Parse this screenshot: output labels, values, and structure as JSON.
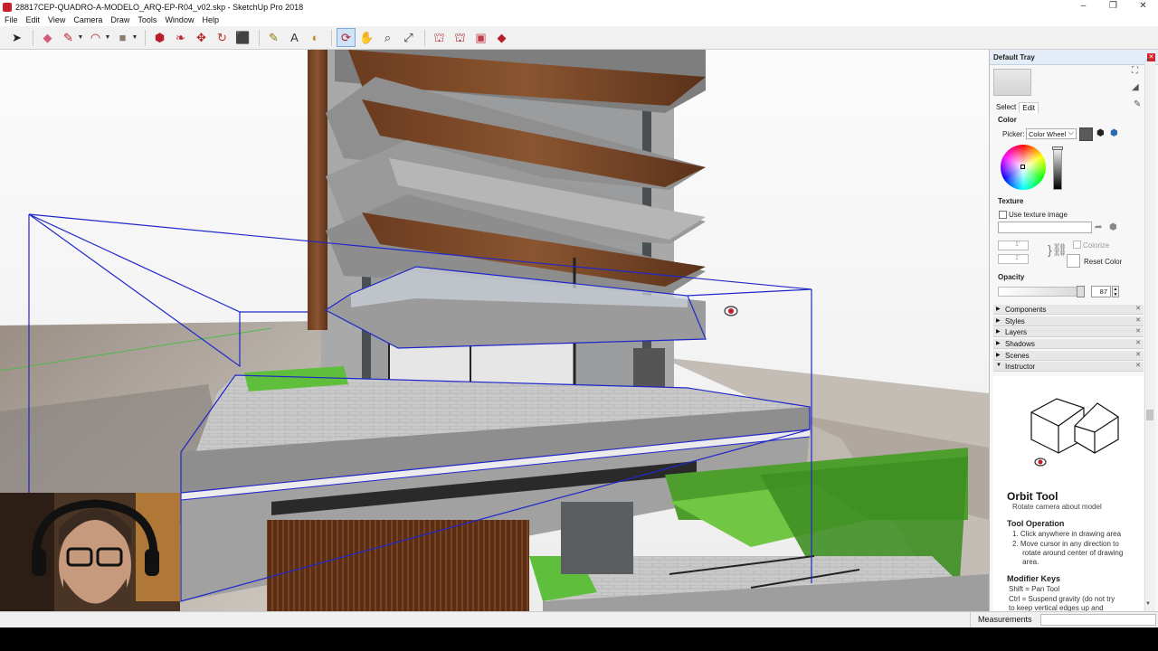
{
  "window": {
    "title": "28817CEP-QUADRO-A-MODELO_ARQ-EP-R04_v02.skp - SketchUp Pro 2018",
    "controls": [
      "–",
      "❐",
      "✕"
    ]
  },
  "menu": [
    "File",
    "Edit",
    "View",
    "Camera",
    "Draw",
    "Tools",
    "Window",
    "Help"
  ],
  "toolbar": {
    "icons": [
      {
        "name": "select-icon",
        "glyph": "➤",
        "color": "#222"
      },
      {
        "name": "eraser-icon",
        "glyph": "◆",
        "color": "#d45a7c"
      },
      {
        "name": "pencil-icon",
        "glyph": "✎",
        "color": "#b5202a"
      },
      {
        "name": "arc-icon",
        "glyph": "◠",
        "color": "#b5202a"
      },
      {
        "name": "rectangle-icon",
        "glyph": "■",
        "color": "#8a7d6f"
      },
      {
        "name": "push-pull-icon",
        "glyph": "⬢",
        "color": "#b5202a"
      },
      {
        "name": "follow-me-icon",
        "glyph": "❧",
        "color": "#b5202a"
      },
      {
        "name": "move-icon",
        "glyph": "✥",
        "color": "#b5202a"
      },
      {
        "name": "rotate-icon",
        "glyph": "↻",
        "color": "#c0302a"
      },
      {
        "name": "scale-icon",
        "glyph": "⬛",
        "color": "#b5202a"
      },
      {
        "name": "tape-measure-icon",
        "glyph": "✎",
        "color": "#8b7a14"
      },
      {
        "name": "text-icon",
        "glyph": "A",
        "color": "#333"
      },
      {
        "name": "paint-bucket-icon",
        "glyph": "◐",
        "color": "#b98c2a"
      },
      {
        "name": "orbit-icon",
        "glyph": "⟳",
        "color": "#b5202a"
      },
      {
        "name": "pan-icon",
        "glyph": "✋",
        "color": "#c68e3a"
      },
      {
        "name": "zoom-icon",
        "glyph": "⌕",
        "color": "#333"
      },
      {
        "name": "zoom-extents-icon",
        "glyph": "⤢",
        "color": "#333"
      },
      {
        "name": "warehouse-icon",
        "glyph": "⛫",
        "color": "#c0303a"
      },
      {
        "name": "extension-warehouse-icon",
        "glyph": "⛫",
        "color": "#a02030"
      },
      {
        "name": "send-to-layout-icon",
        "glyph": "▣",
        "color": "#c23a4a"
      },
      {
        "name": "extension-icon",
        "glyph": "◆",
        "color": "#b5202a"
      }
    ]
  },
  "tray": {
    "title": "Default Tray",
    "tabs": [
      "Select",
      "Edit"
    ],
    "color": {
      "section_label": "Color",
      "picker_label": "Picker:",
      "picker_value": "Color Wheel",
      "current_color": "#5a5a5a"
    },
    "texture": {
      "section_label": "Texture",
      "use_texture_label": "Use texture image",
      "width_value": "1'",
      "height_value": "1'",
      "colorize_label": "Colorize",
      "reset_color_label": "Reset Color"
    },
    "opacity": {
      "section_label": "Opacity",
      "value": "87"
    },
    "panels": [
      "Components",
      "Styles",
      "Layers",
      "Shadows",
      "Scenes",
      "Instructor"
    ],
    "instructor": {
      "tool_name": "Orbit Tool",
      "tool_desc": "Rotate camera about model",
      "operation_head": "Tool Operation",
      "operation_steps": [
        "1.  Click anywhere in drawing area",
        "2.  Move cursor in any direction to",
        "     rotate around center of drawing",
        "     area."
      ],
      "modifier_head": "Modifier Keys",
      "modifier_lines": [
        "Shift = Pan Tool",
        "Ctrl = Suspend gravity (do not try",
        "to keep vertical edges up and"
      ]
    }
  },
  "status": {
    "measurements_label": "Measurements",
    "measurements_value": ""
  }
}
